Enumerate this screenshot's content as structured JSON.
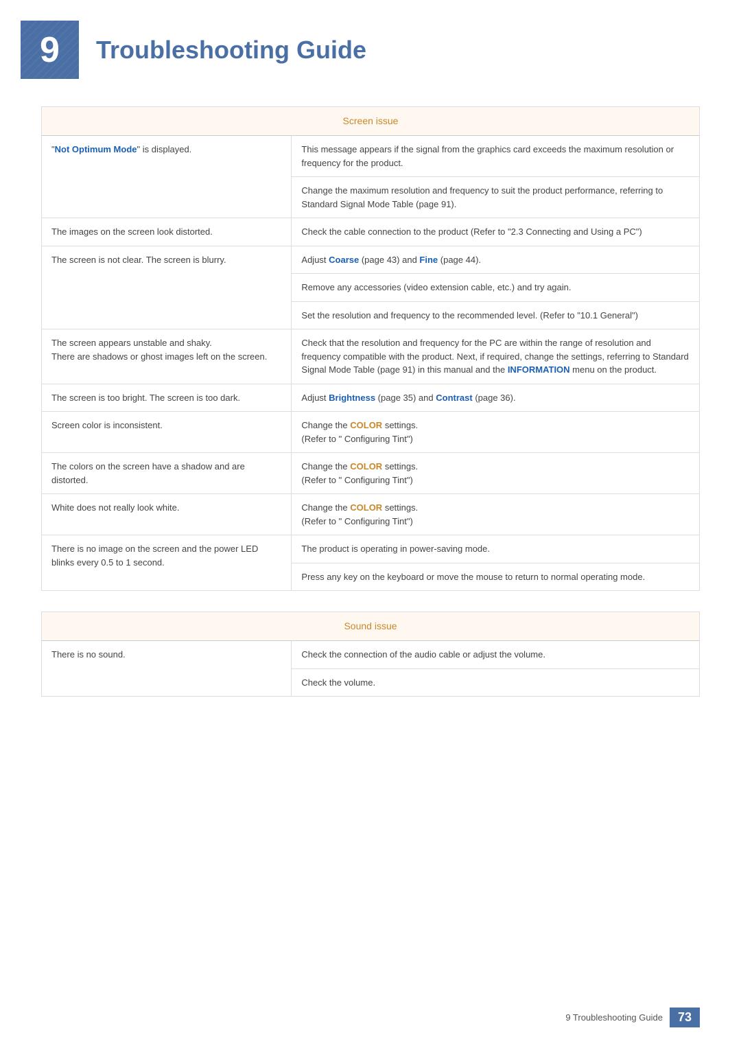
{
  "header": {
    "chapter_number": "9",
    "title": "Troubleshooting Guide"
  },
  "screen_issue": {
    "section_title": "Screen issue",
    "rows": [
      {
        "problem": "\"Not Optimum Mode\" is displayed.",
        "problem_highlight": "Not Optimum Mode",
        "solutions": [
          "This message appears if the signal from the graphics card exceeds the maximum resolution or frequency for the product.",
          "Change the maximum resolution and frequency to suit the product performance, referring to Standard Signal Mode Table (page 91)."
        ]
      },
      {
        "problem": "The images on the screen look distorted.",
        "solutions": [
          "Check the cable connection to the product (Refer to \"2.3 Connecting and Using a PC\")"
        ]
      },
      {
        "problem": "The screen is not clear. The screen is blurry.",
        "solutions": [
          "Adjust Coarse (page 43) and Fine (page 44).",
          "Remove any accessories (video extension cable, etc.) and try again.",
          "Set the resolution and frequency to the recommended level. (Refer to \"10.1 General\")"
        ]
      },
      {
        "problem_multi": [
          "The screen appears unstable and shaky.",
          "There are shadows or ghost images left on the screen."
        ],
        "solutions": [
          "Check that the resolution and frequency for the PC are within the range of resolution and frequency compatible with the product. Next, if required, change the settings, referring to Standard Signal Mode Table (page 91) in this manual and the INFORMATION menu on the product."
        ]
      },
      {
        "problem": "The screen is too bright. The screen is too dark.",
        "solutions": [
          "Adjust Brightness (page 35) and Contrast (page 36)."
        ]
      },
      {
        "problem": "Screen color is inconsistent.",
        "solutions": [
          "Change the COLOR settings.\n(Refer to \" Configuring Tint\")"
        ]
      },
      {
        "problem": "The colors on the screen have a shadow and are distorted.",
        "solutions": [
          "Change the COLOR settings.\n(Refer to \" Configuring Tint\")"
        ]
      },
      {
        "problem": "White does not really look white.",
        "solutions": [
          "Change the COLOR settings.\n(Refer to \" Configuring Tint\")"
        ]
      },
      {
        "problem_multi": [
          "There is no image on the screen and the power LED blinks every 0.5 to 1 second."
        ],
        "solutions": [
          "The product is operating in power-saving mode.",
          "Press any key on the keyboard or move the mouse to return to normal operating mode."
        ]
      }
    ]
  },
  "sound_issue": {
    "section_title": "Sound issue",
    "rows": [
      {
        "problem": "There is no sound.",
        "solutions": [
          "Check the connection of the audio cable or adjust the volume.",
          "Check the volume."
        ]
      }
    ]
  },
  "footer": {
    "chapter_label": "9 Troubleshooting Guide",
    "page_number": "73"
  }
}
